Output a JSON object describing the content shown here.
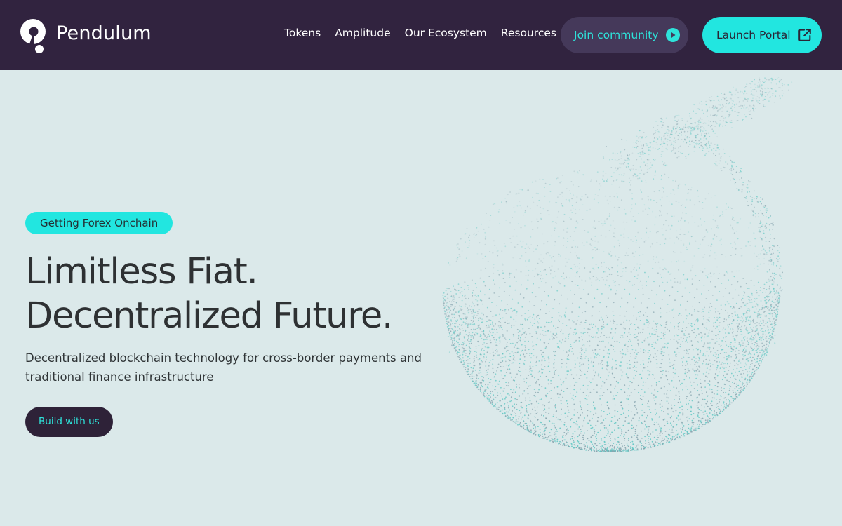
{
  "nav": {
    "brand": "Pendulum",
    "links": [
      "Tokens",
      "Amplitude",
      "Our Ecosystem",
      "Resources"
    ],
    "join_label": "Join community",
    "launch_label": "Launch Portal"
  },
  "hero": {
    "badge": "Getting Forex Onchain",
    "headline_line1": "Limitless Fiat.",
    "headline_line2": "Decentralized Future.",
    "subtext": "Decentralized blockchain technology for cross-border payments and traditional finance infrastructure",
    "cta_label": "Build with us"
  },
  "icons": {
    "logo": "pendulum-logo-icon",
    "join": "play-circle-icon",
    "launch": "external-link-icon",
    "illustration": "particle-sphere-graphic"
  },
  "colors": {
    "nav_bg": "#31233f",
    "page_bg": "#dbe9ea",
    "accent": "#22e6e0",
    "dark_button": "#2e2238",
    "join_bg": "#45395a",
    "text_dark": "#2e3133"
  }
}
